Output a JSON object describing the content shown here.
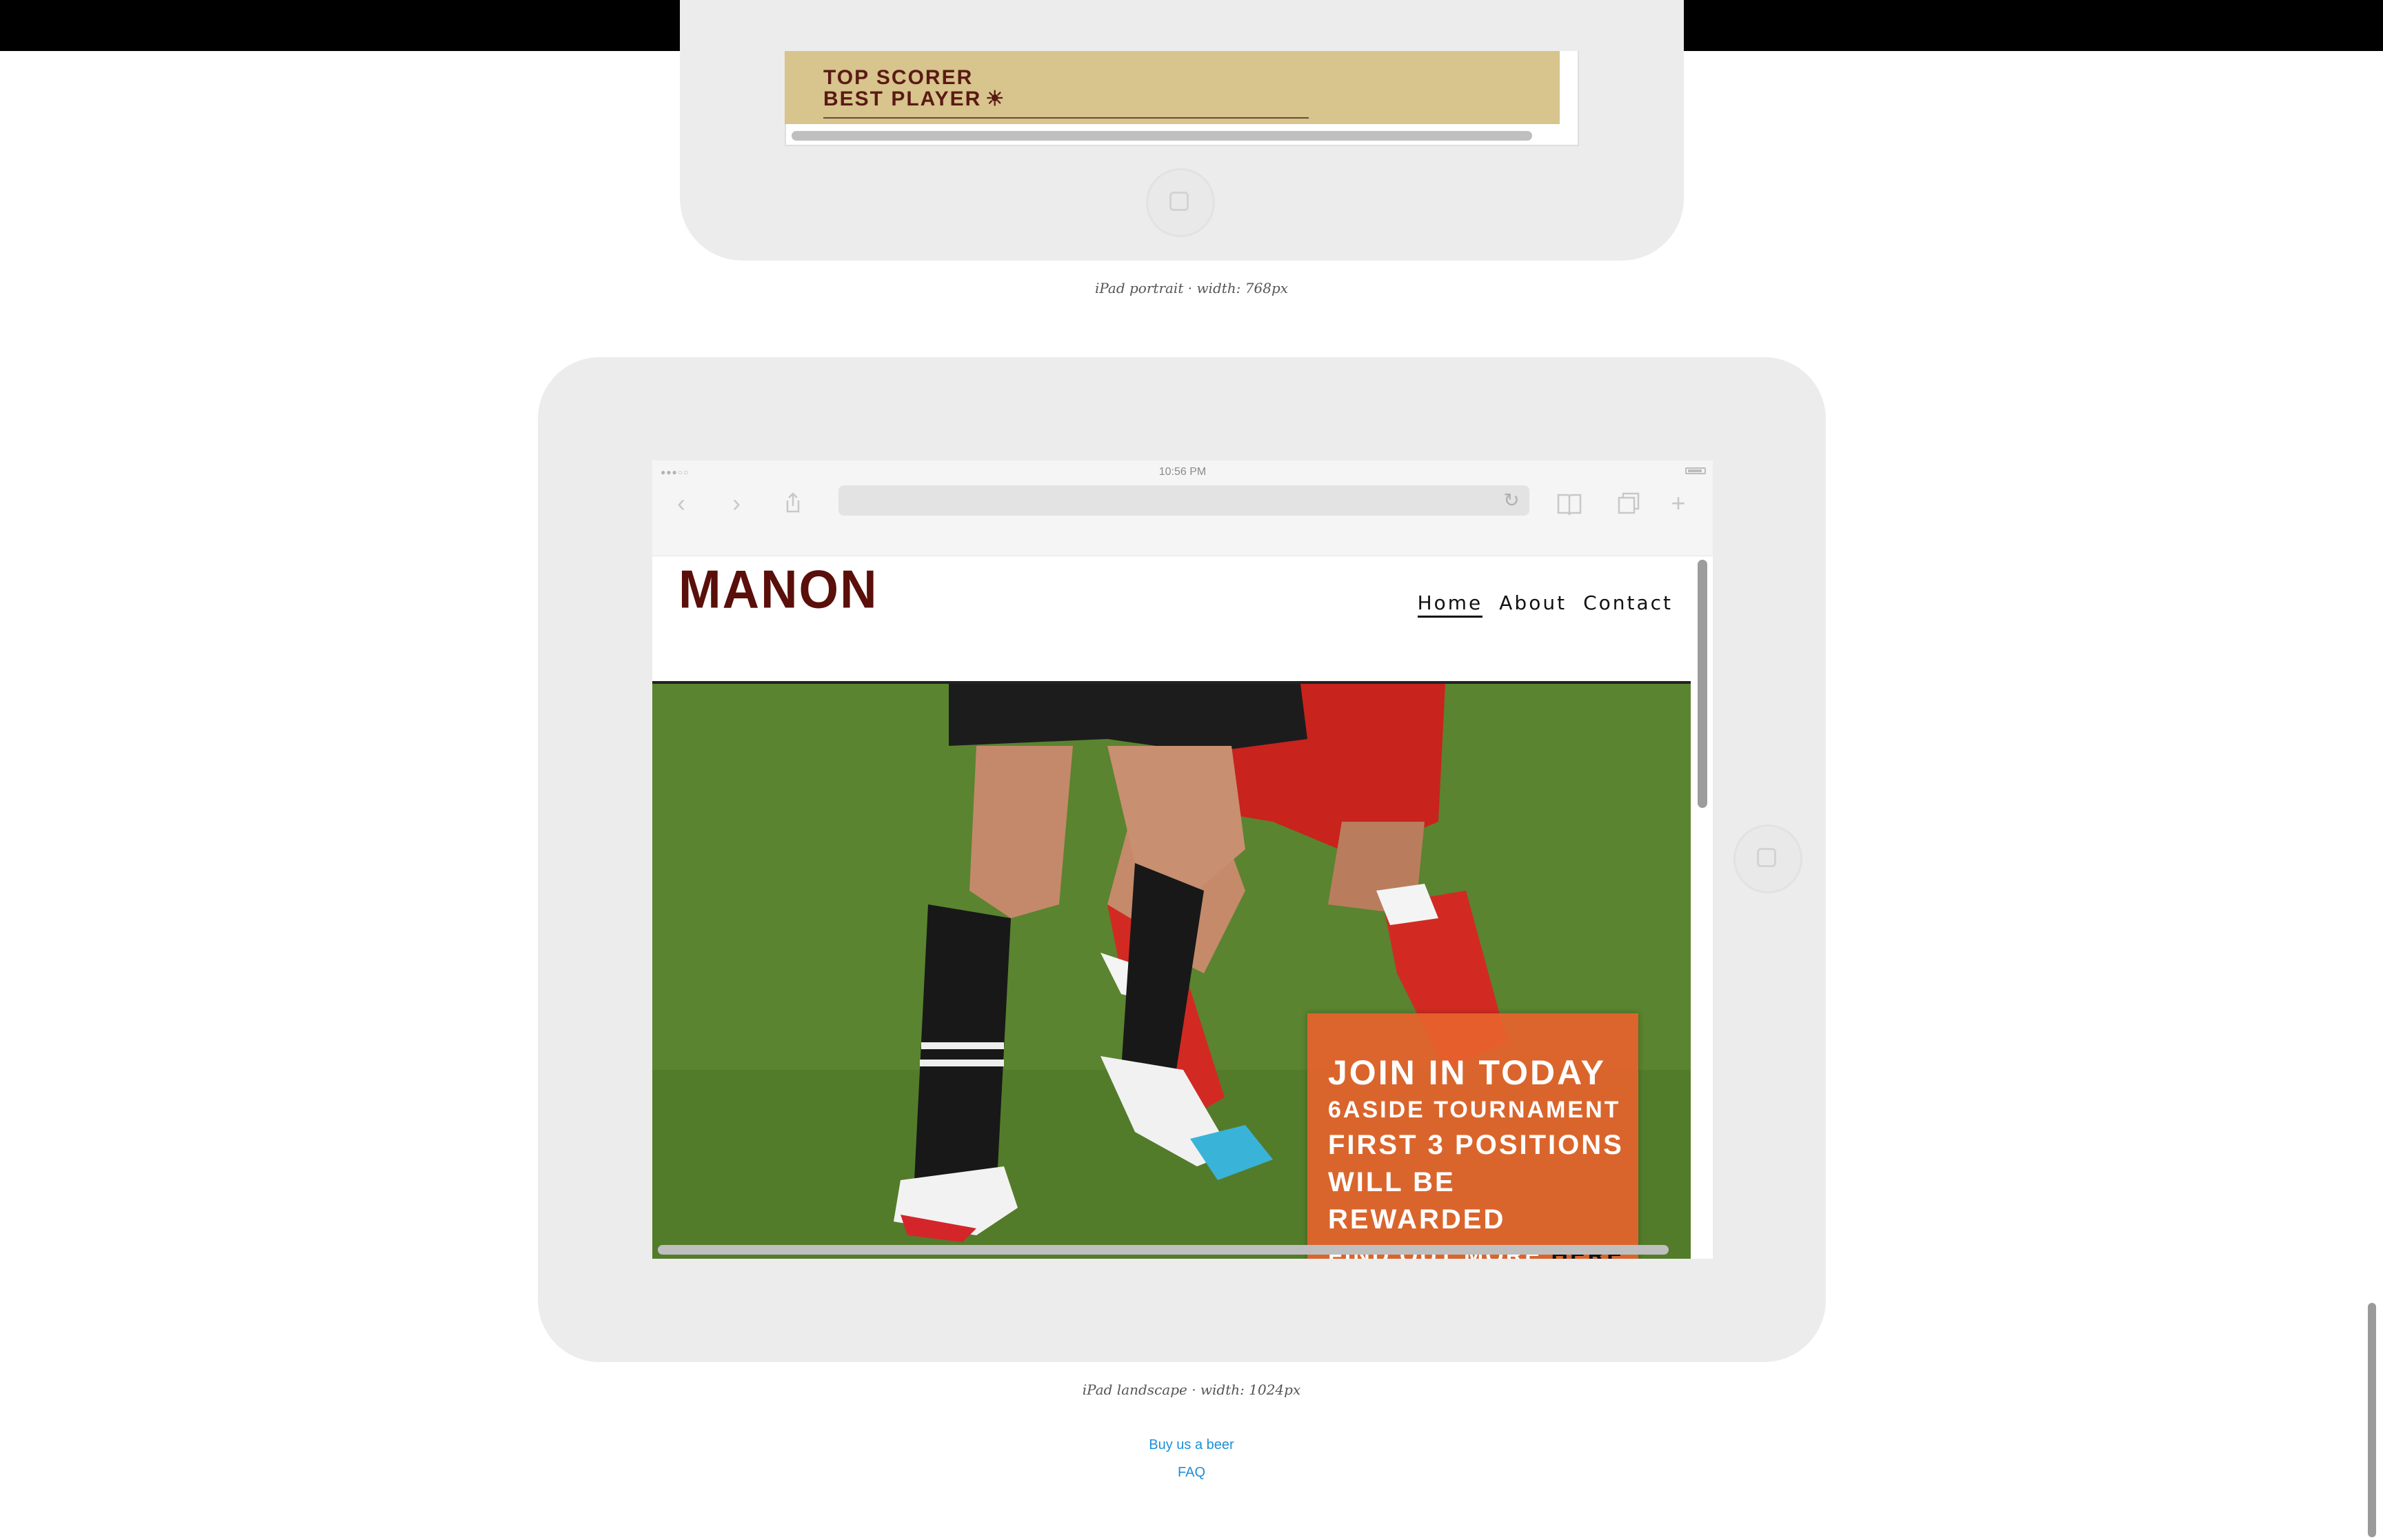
{
  "portrait_device": {
    "footer_line1": "TOP SCORER",
    "footer_line2": "BEST PLAYER",
    "footer_icon": "star-burst-icon",
    "footer_bg": "#d8c48d",
    "caption": "iPad portrait · width: 768px"
  },
  "landscape_device": {
    "caption": "iPad landscape · width: 1024px",
    "safari": {
      "status_time": "10:56 PM",
      "status_dots": "●●●○○",
      "icons": [
        "back-icon",
        "forward-icon",
        "share-icon",
        "reload-icon",
        "bookmarks-icon",
        "tabs-icon",
        "new-tab-icon"
      ]
    },
    "site": {
      "logo": "MANON",
      "logo_color": "#5a0f0a",
      "nav": [
        {
          "label": "Home",
          "active": true
        },
        {
          "label": "About",
          "active": false
        },
        {
          "label": "Contact",
          "active": false
        }
      ],
      "promo": {
        "title": "JOIN IN TODAY",
        "subtitle": "6ASIDE TOURNAMENT",
        "body": "FIRST 3 POSITIONS WILL BE REWARDED",
        "more_prefix": "FIND OUT MORE",
        "more_link": "HERE",
        "bg": "#e6632d"
      }
    }
  },
  "footer": {
    "links": [
      "Buy us a beer",
      "FAQ"
    ],
    "link_color": "#1d8fd8"
  }
}
